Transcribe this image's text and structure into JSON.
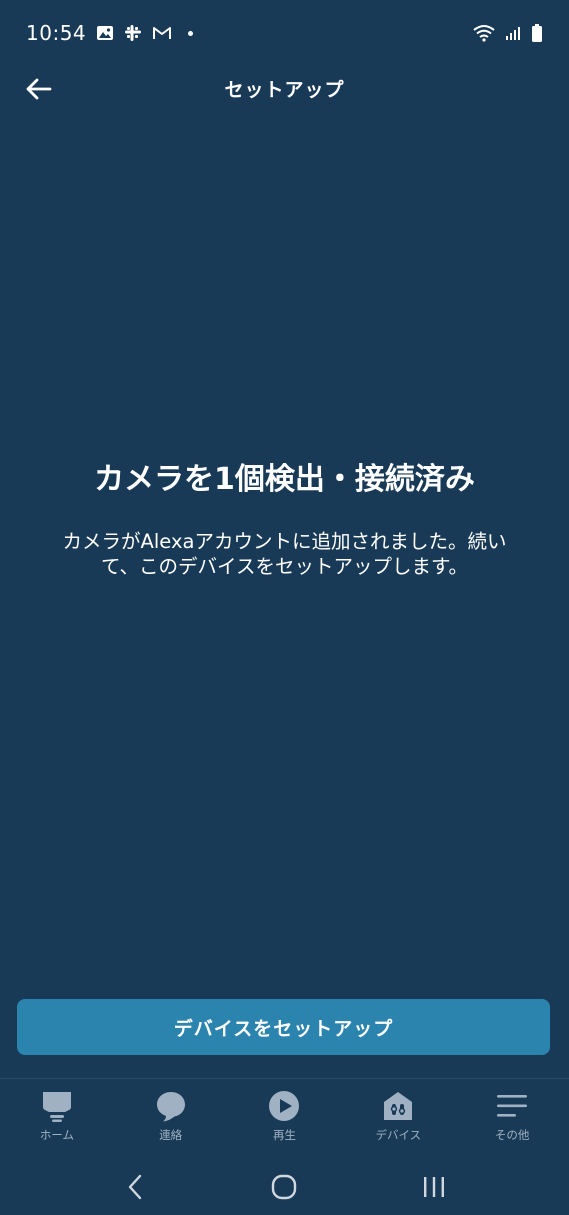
{
  "status_bar": {
    "time": "10:54",
    "left_icons": [
      "image-icon",
      "slack-icon",
      "gmail-icon",
      "dot-icon"
    ],
    "right_icons": [
      "wifi-icon",
      "signal-icon",
      "battery-icon"
    ]
  },
  "header": {
    "title": "セットアップ",
    "back_icon": "arrow-left-icon"
  },
  "main": {
    "heading": "カメラを1個検出・接続済み",
    "description": "カメラがAlexaアカウントに追加されました。続いて、このデバイスをセットアップします。"
  },
  "setup_button": {
    "label": "デバイスをセットアップ"
  },
  "bottom_nav": {
    "items": [
      {
        "label": "ホーム",
        "icon": "home-icon"
      },
      {
        "label": "連絡",
        "icon": "chat-bubble-icon"
      },
      {
        "label": "再生",
        "icon": "play-icon"
      },
      {
        "label": "デバイス",
        "icon": "devices-icon"
      },
      {
        "label": "その他",
        "icon": "menu-icon"
      }
    ]
  },
  "system_bar": {
    "buttons": [
      "back-chevron-icon",
      "home-circle-icon",
      "recents-icon"
    ]
  },
  "colors": {
    "background": "#193a56",
    "button": "#2b84ae",
    "nav_label": "#9fb1c2"
  }
}
